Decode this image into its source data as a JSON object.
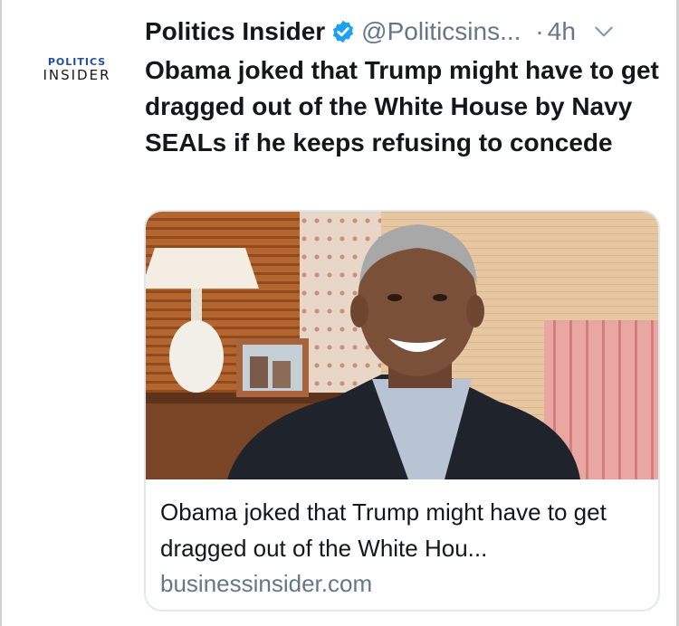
{
  "account": {
    "logo_line1": "POLITICS",
    "logo_line2": "INSIDER",
    "name": "Politics Insider",
    "handle": "@Politicsins...",
    "separator": "·",
    "time": "4h",
    "verified_icon": "verified-badge-icon",
    "menu_icon": "chevron-down-icon"
  },
  "tweet": {
    "text": "Obama joked that Trump might have to get dragged out of the White House by Navy SEALs if he keeps refusing to concede"
  },
  "card": {
    "image_alt": "photo-of-smiling-man-in-living-room",
    "title": "Obama joked that Trump might have to get dragged out of the White Hou...",
    "domain": "businessinsider.com"
  },
  "colors": {
    "text": "#14171a",
    "secondary": "#657786",
    "verified": "#1da1f2",
    "logo_blue": "#1d4fa0",
    "card_border": "#e1e8ed"
  }
}
